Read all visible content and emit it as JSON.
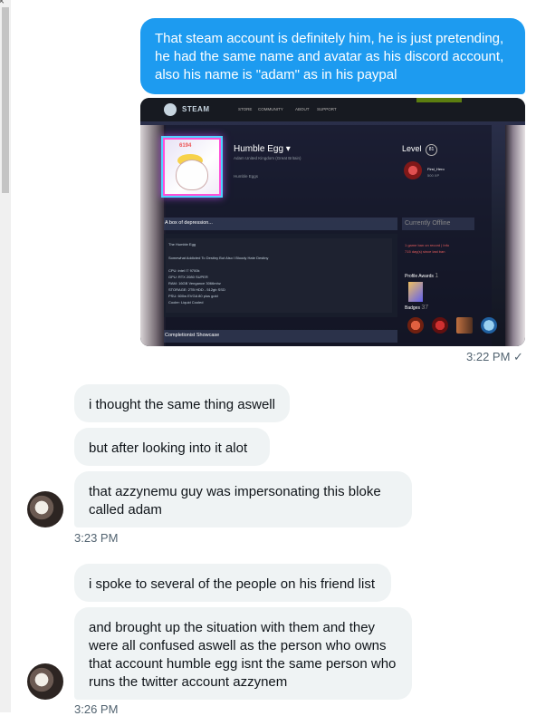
{
  "chat": {
    "messages": [
      {
        "id": "m1",
        "direction": "out",
        "text": "That steam account is definitely him, he is just pretending, he had the same name and avatar as his discord account, also his name is \"adam\" as in his paypal"
      },
      {
        "id": "m2",
        "direction": "in",
        "text": "i thought the same thing aswell"
      },
      {
        "id": "m3",
        "direction": "in",
        "text": "but after looking into it alot"
      },
      {
        "id": "m4",
        "direction": "in",
        "text": "that azzynemu guy was impersonating this bloke called adam"
      },
      {
        "id": "m5",
        "direction": "in",
        "text": "i spoke to several of the people on his friend list"
      },
      {
        "id": "m6",
        "direction": "in",
        "text": "and brought up the situation with them and they were all confused aswell as the person who owns that account humble egg isnt the same person who runs the twitter account azzynem"
      }
    ],
    "timestamps": {
      "out1": "3:22 PM",
      "read_mark": "✓",
      "in1": "3:23 PM",
      "in2": "3:26 PM"
    },
    "close_glyph": "×"
  },
  "steam_screenshot": {
    "logo_text": "STEAM",
    "nav": [
      "STORE",
      "COMMUNITY",
      "ABOUT",
      "SUPPORT"
    ],
    "avatar_text": "6194",
    "profile_name": "Humble Egg ▾",
    "real_name_line": "Adam  United Kingdom (Great Britain)",
    "status_line": "Humble Eggs",
    "level_label": "Level",
    "level_value": "81",
    "favorite_badge_name": "First_Hero",
    "favorite_badge_xp": "500 XP",
    "summary_title": "A box of depression...",
    "summary_lines": [
      "The Humble Egg",
      "Somewhat Addicted To Destiny But Also I Bloody Hate Destiny",
      "CPU: intel I7 9700k",
      "GPU: RTX 2080 SUPER",
      "RAM: 16GB Vengance 3066mhz",
      "STORAGE: 2TB HDD - 512gb SSD",
      "PSU: 600w EVGA 80 plus gold",
      "Cooler: Liquid Cooled"
    ],
    "online_status": "Currently Offline",
    "ban_line_1": "1 game ban on record | Info",
    "ban_line_2": "715 day(s) since last ban",
    "awards_label": "Profile Awards",
    "awards_count": "1",
    "badges_label": "Badges",
    "badges_count": "37",
    "showcase_title": "Completionist Showcase"
  }
}
